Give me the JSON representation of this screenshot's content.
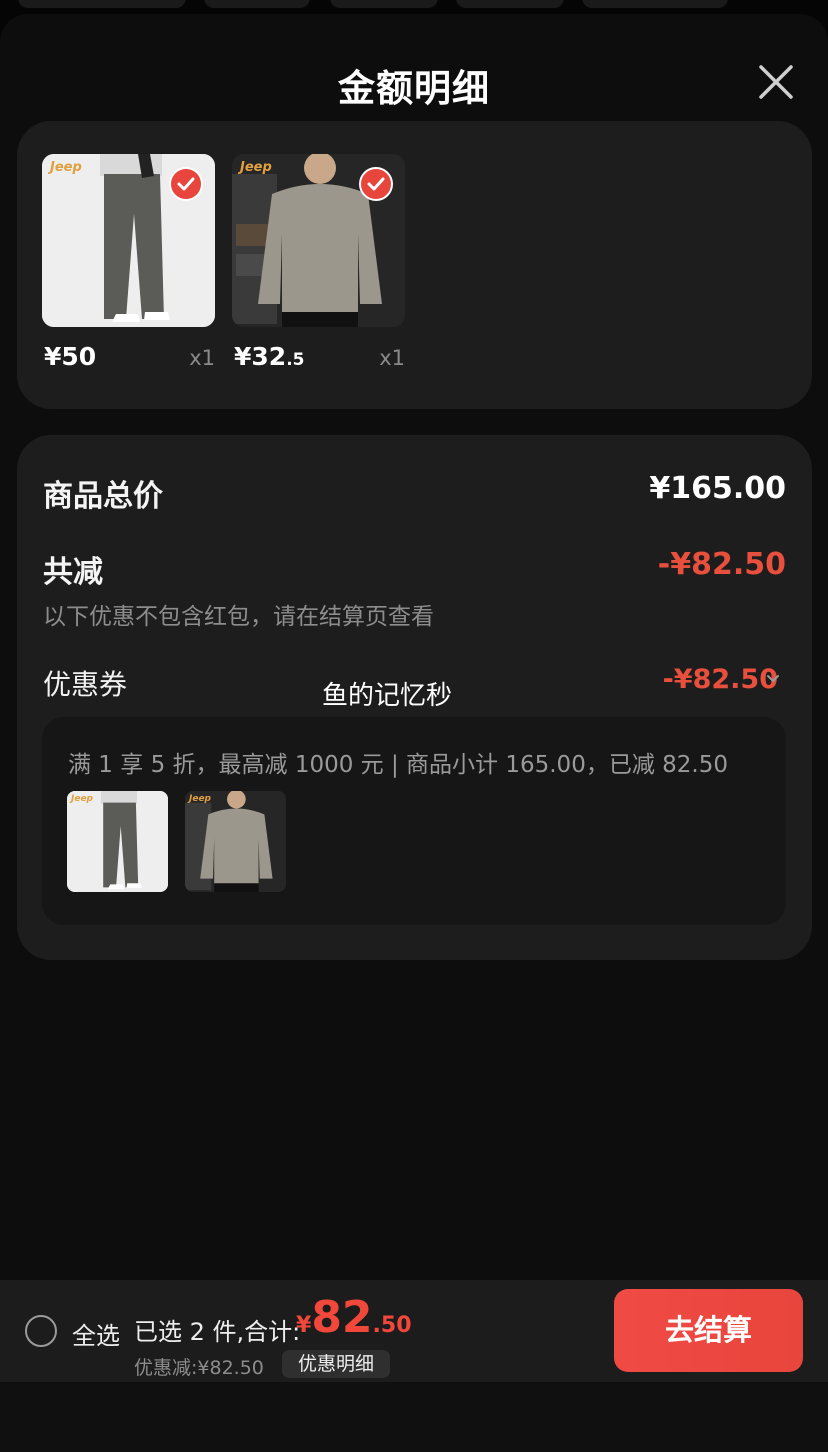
{
  "sheet": {
    "title": "金额明细"
  },
  "colors": {
    "accent": "#e8453c",
    "sheet_bg": "#0d0d0d",
    "card_bg": "#1d1d1d"
  },
  "icons": {
    "close": "close-icon",
    "check": "check-icon",
    "chevron": "chevron-down-icon",
    "radio": "radio-unchecked-icon"
  },
  "products": [
    {
      "brand": "Jeep",
      "price_int": "¥50",
      "price_frac": "",
      "qty": "x1",
      "selected": true
    },
    {
      "brand": "Jeep",
      "price_int": "¥32",
      "price_frac": ".5",
      "qty": "x1",
      "selected": true
    }
  ],
  "summary": {
    "total_label": "商品总价",
    "total_value": "¥165.00",
    "reduce_label": "共减",
    "reduce_value": "-¥82.50",
    "note": "以下优惠不包含红包，请在结算页查看",
    "coupon_label": "优惠券",
    "coupon_value": "-¥82.50",
    "coupon_rule": "满 1 享 5 折，最高减 1000 元 | 商品小计 165.00，已减 82.50"
  },
  "watermark": "鱼的记忆秒",
  "bottom_bar": {
    "select_all_label": "全选",
    "selected_text": "已选 2 件,合计:",
    "total_currency": "¥",
    "total_int": "82",
    "total_frac": ".50",
    "discount_text": "优惠减:¥82.50",
    "detail_button": "优惠明细",
    "checkout_button": "去结算"
  }
}
